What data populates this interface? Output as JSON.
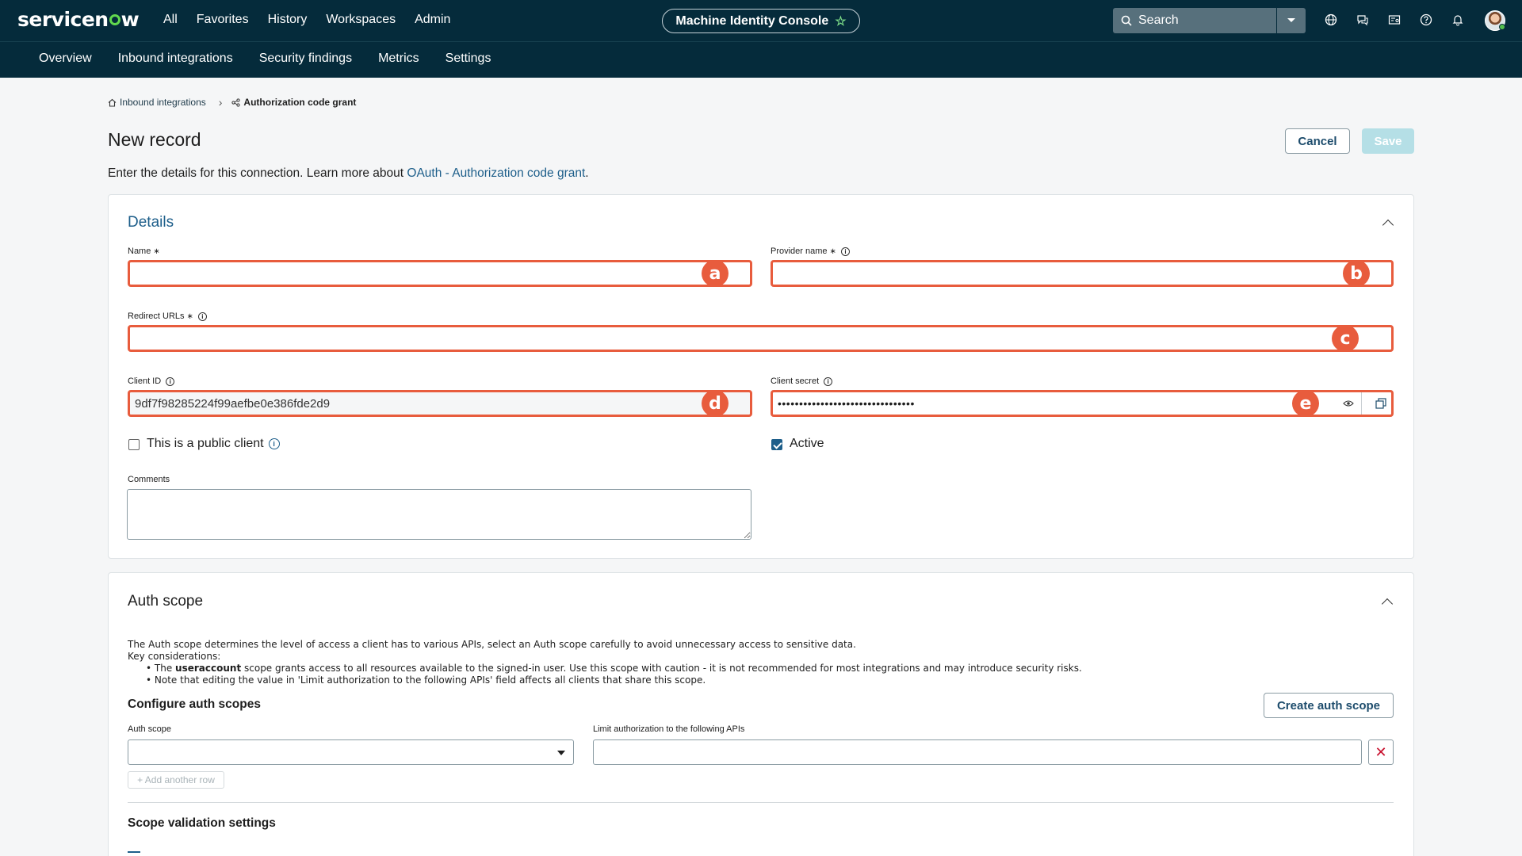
{
  "header": {
    "logo": "servicenow",
    "nav": [
      "All",
      "Favorites",
      "History",
      "Workspaces",
      "Admin"
    ],
    "console_title": "Machine Identity Console",
    "search_placeholder": "Search"
  },
  "subnav": [
    "Overview",
    "Inbound integrations",
    "Security findings",
    "Metrics",
    "Settings"
  ],
  "breadcrumb": {
    "parent": "Inbound integrations",
    "current": "Authorization code grant"
  },
  "page": {
    "title": "New record",
    "cancel": "Cancel",
    "save": "Save",
    "intro_text": "Enter the details for this connection. Learn more about ",
    "intro_link": "OAuth - Authorization code grant",
    "intro_tail": "."
  },
  "details": {
    "title": "Details",
    "name_label": "Name",
    "provider_label": "Provider name",
    "redirect_label": "Redirect URLs",
    "client_id_label": "Client ID",
    "client_id_value": "9df7f98285224f99aefbe0e386fde2d9",
    "client_secret_label": "Client secret",
    "client_secret_value": "••••••••••••••••••••••••••••••••",
    "public_client_label": "This is a public client",
    "active_label": "Active",
    "comments_label": "Comments",
    "required_mark": "∗",
    "badges": [
      "a",
      "b",
      "c",
      "d",
      "e"
    ]
  },
  "auth_scope": {
    "title": "Auth scope",
    "desc": "The Auth scope determines the level of access a client has to various APIs, select an Auth scope carefully to avoid unnecessary access to sensitive data.",
    "key_considerations": "Key considerations:",
    "bullet1_pre": "The ",
    "bullet1_bold": "useraccount",
    "bullet1_post": " scope grants access to all resources available to the signed-in user. Use this scope with caution - it is not recommended for most integrations and may introduce security risks.",
    "bullet2": "Note that editing the value in 'Limit authorization to the following APIs' field affects all clients that share this scope.",
    "configure_heading": "Configure auth scopes",
    "create_button": "Create auth scope",
    "auth_scope_label": "Auth scope",
    "limit_label": "Limit authorization to the following APIs",
    "add_row": "+ Add another row",
    "scope_validation": "Scope validation settings"
  },
  "colors": {
    "brand": "#052b3b",
    "annotation": "#e85c3d",
    "link": "#1d5e8a"
  }
}
